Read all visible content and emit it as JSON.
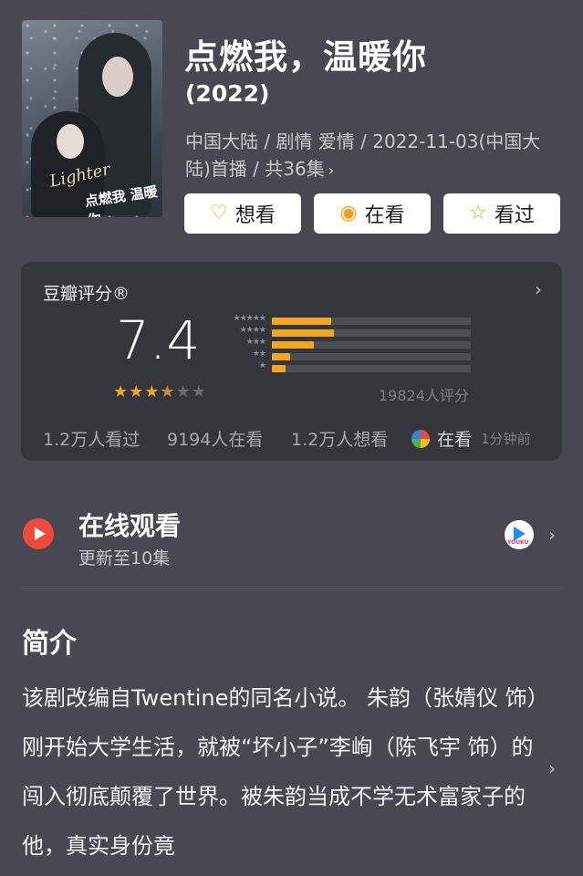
{
  "show": {
    "title": "点燃我，温暖你",
    "year": "(2022)",
    "meta": "中国大陆 / 剧情 爱情 / 2022-11-03(中国大陆)首播 / 共36集",
    "poster_title": "点燃我 温暖你",
    "poster_script": "Lighter"
  },
  "actions": {
    "want": "想看",
    "watching": "在看",
    "watched": "看过"
  },
  "rating": {
    "label": "豆瓣评分®",
    "score": "7.4",
    "stars_on": "★★★",
    "stars_half": "★",
    "stars_off": "★★",
    "count": "19824人评分",
    "distribution": [
      {
        "stars": "★★★★★",
        "fraction": 0.3
      },
      {
        "stars": "★★★★",
        "fraction": 0.31
      },
      {
        "stars": "★★★",
        "fraction": 0.21
      },
      {
        "stars": "★★",
        "fraction": 0.09
      },
      {
        "stars": "★",
        "fraction": 0.07
      }
    ],
    "stats": {
      "watched": "1.2万人看过",
      "watching": "9194人在看",
      "want": "1.2万人想看"
    },
    "friend_status": "在看",
    "friend_time": "1分钟前"
  },
  "online": {
    "title": "在线观看",
    "subtitle": "更新至10集",
    "platform_icon": "youku-icon",
    "platform_mark": "YOUKU"
  },
  "intro": {
    "heading": "简介",
    "text": "该剧改编自Twentine的同名小说。 朱韵（张婧仪 饰）刚开始大学生活，就被“坏小子”李峋（陈飞宇 饰）的闯入彻底颠覆了世界。被朱韵当成不学无术富家子的他，真实身份竟"
  },
  "colors": {
    "background": "#484752",
    "card": "#35353e",
    "accent": "#f5a623",
    "play": "#ef4a3b"
  }
}
